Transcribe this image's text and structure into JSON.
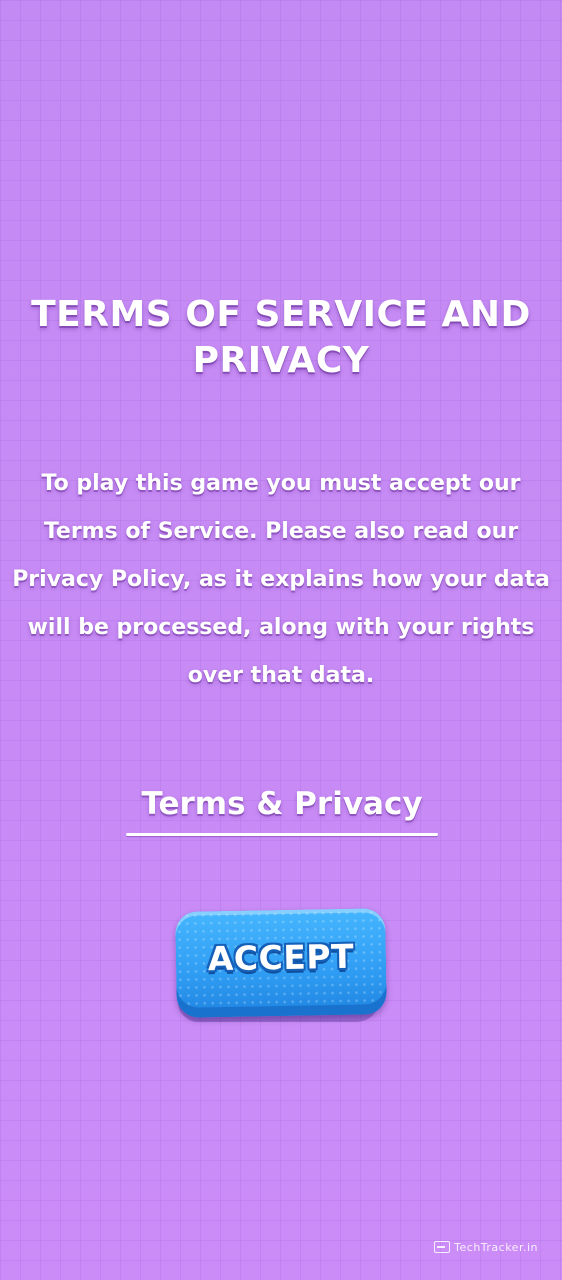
{
  "dialog": {
    "title": "TERMS OF SERVICE AND PRIVACY",
    "message": "To play this game you must accept our Terms of Service. Please also read our Privacy Policy, as it explains how your data will be processed, along with your rights over that data.",
    "terms_link_label": "Terms & Privacy",
    "accept_label": "ACCEPT"
  },
  "watermark": {
    "text": "TechTracker.in",
    "icon": "browser-window-icon"
  },
  "colors": {
    "background": "#c889f5",
    "accept_button": "#2f9cf3",
    "text": "#ffffff"
  }
}
